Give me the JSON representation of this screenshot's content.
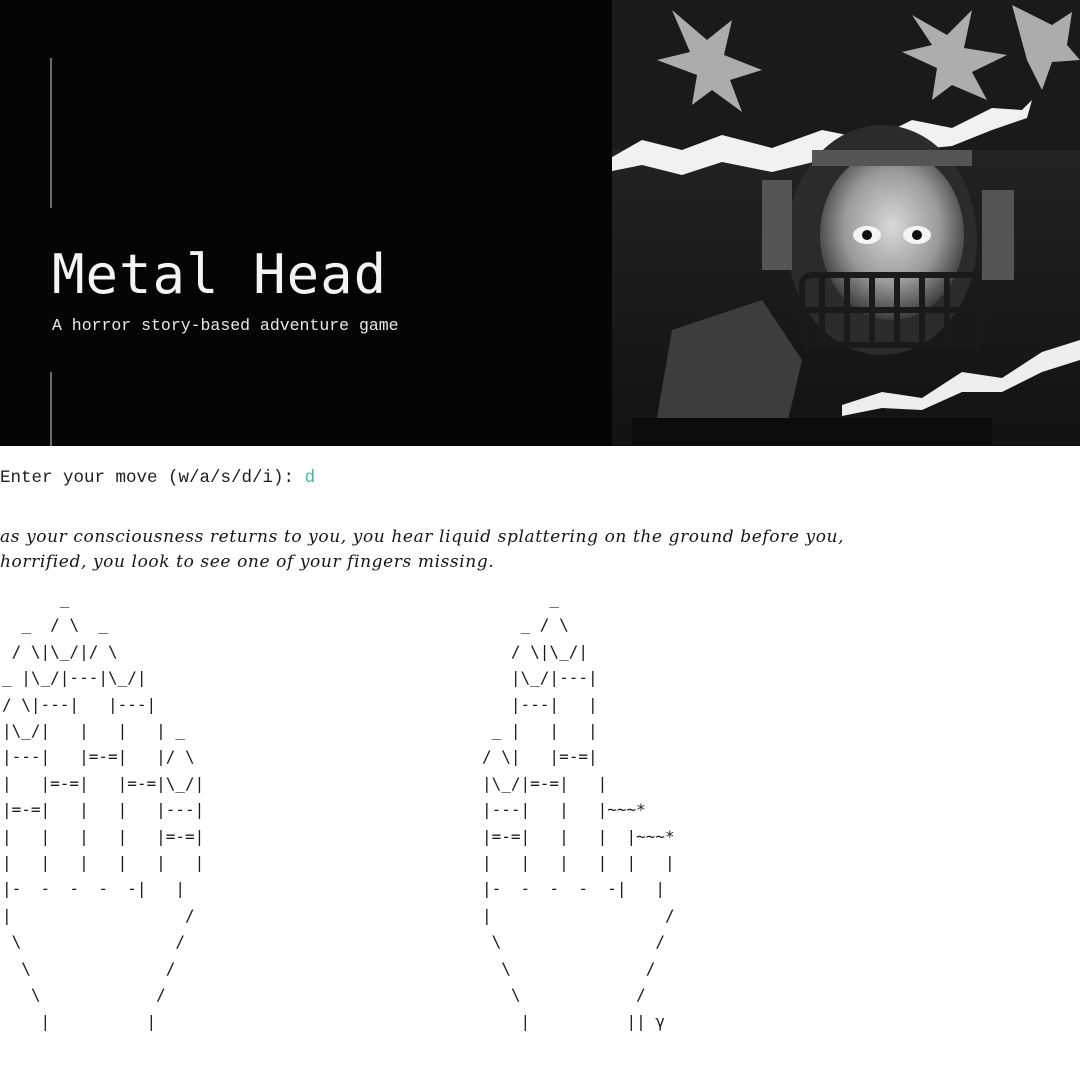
{
  "banner": {
    "title": "Metal Head",
    "subtitle": "A horror story-based adventure game"
  },
  "terminal": {
    "prompt": "Enter your move (w/a/s/d/i): ",
    "input": "d",
    "story_lines": [
      "as your consciousness returns to you, you hear liquid splattering on the ground before you,",
      "horrified, you look to see one of your fingers missing."
    ],
    "hand_left": "      _\n  _  / \\  _\n / \\|\\_/|/ \\\n_ |\\_/|---|\\_/|\n/ \\|---|   |---|\n|\\_/|   |   |   | _\n|---|   |=-=|   |/ \\\n|   |=-=|   |=-=|\\_/|\n|=-=|   |   |   |---|\n|   |   |   |   |=-=|\n|   |   |   |   |   |\n|-  -  -  -  -|   |\n|                  /\n \\                /\n  \\              /\n   \\            /\n    |          |",
    "hand_right": "       _\n    _ / \\\n   / \\|\\_/|\n   |\\_/|---|\n   |---|   |\n _ |   |   |\n/ \\|   |=-=|\n|\\_/|=-=|   |\n|---|   |   |~~~*\n|=-=|   |   |  |~~~*\n|   |   |   |  |   |\n|-  -  -  -  -|   |\n|                  /\n \\                /\n  \\              /\n   \\            /\n    |          || γ"
  }
}
